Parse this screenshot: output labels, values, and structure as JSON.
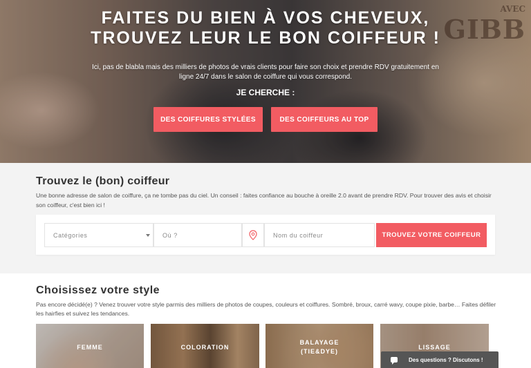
{
  "hero": {
    "title_line1": "FAITES DU BIEN À VOS CHEVEUX,",
    "title_line2": "TROUVEZ LEUR LE BON COIFFEUR !",
    "subtitle_line1": "Ici, pas de blabla mais des milliers de photos de vrais clients pour faire son choix et prendre RDV gratuitement en",
    "subtitle_line2": "ligne 24/7 dans le salon de coiffure qui vous correspond.",
    "seek_label": "JE CHERCHE :",
    "btn_styles": "DES COIFFURES STYLÉES",
    "btn_hairdressers": "DES COIFFEURS AU TOP",
    "sign_top": "AVEC",
    "sign_main": "GIBB"
  },
  "find": {
    "title": "Trouvez le (bon) coiffeur",
    "description": "Une bonne adresse de salon de coiffure, ça ne tombe pas du ciel. Un conseil : faites confiance au bouche à oreille 2.0 avant de prendre RDV. Pour trouver des avis et choisir son coiffeur, c'est bien ici !",
    "category_placeholder": "Catégories",
    "where_placeholder": "Où ?",
    "name_placeholder": "Nom du coiffeur",
    "submit_label": "TROUVEZ VOTRE COIFFEUR"
  },
  "style": {
    "title": "Choisissez votre style",
    "description": "Pas encore décidé(e) ? Venez trouver votre style parmis des milliers de photos de coupes, couleurs et coiffures. Sombré, broux, carré wavy, coupe pixie, barbe… Faites défiler les hairfies et suivez les tendances.",
    "cards": [
      {
        "label": "FEMME"
      },
      {
        "label": "COLORATION"
      },
      {
        "label_line1": "BALAYAGE",
        "label_line2": "(TIE&DYE)"
      },
      {
        "label": "LISSAGE"
      }
    ]
  },
  "chat": {
    "label": "Des questions ? Discutons !"
  },
  "colors": {
    "accent": "#f25c62",
    "section_bg": "#f3f3f3",
    "chat_bg": "#555555"
  }
}
